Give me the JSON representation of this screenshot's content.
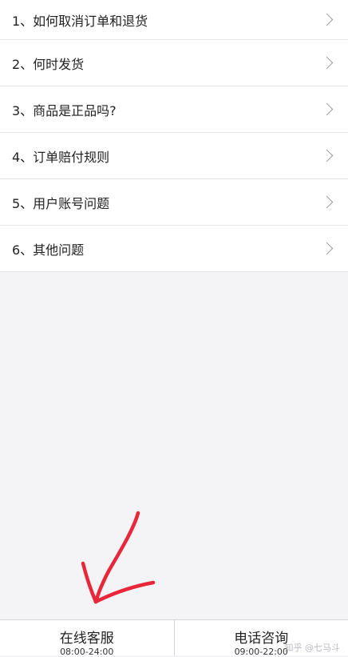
{
  "faq": {
    "items": [
      {
        "label": "1、如何取消订单和退货"
      },
      {
        "label": "2、何时发货"
      },
      {
        "label": "3、商品是正品吗?"
      },
      {
        "label": "4、订单赔付规则"
      },
      {
        "label": "5、用户账号问题"
      },
      {
        "label": "6、其他问题"
      }
    ]
  },
  "bottom_bar": {
    "online": {
      "title": "在线客服",
      "hours": "08:00-24:00"
    },
    "phone": {
      "title": "电话咨询",
      "hours": "09:00-22:00"
    }
  },
  "watermark": "知乎 @七马斗",
  "colors": {
    "page_background": "#f4f4f7",
    "annotation_arrow": "#e8283a"
  }
}
